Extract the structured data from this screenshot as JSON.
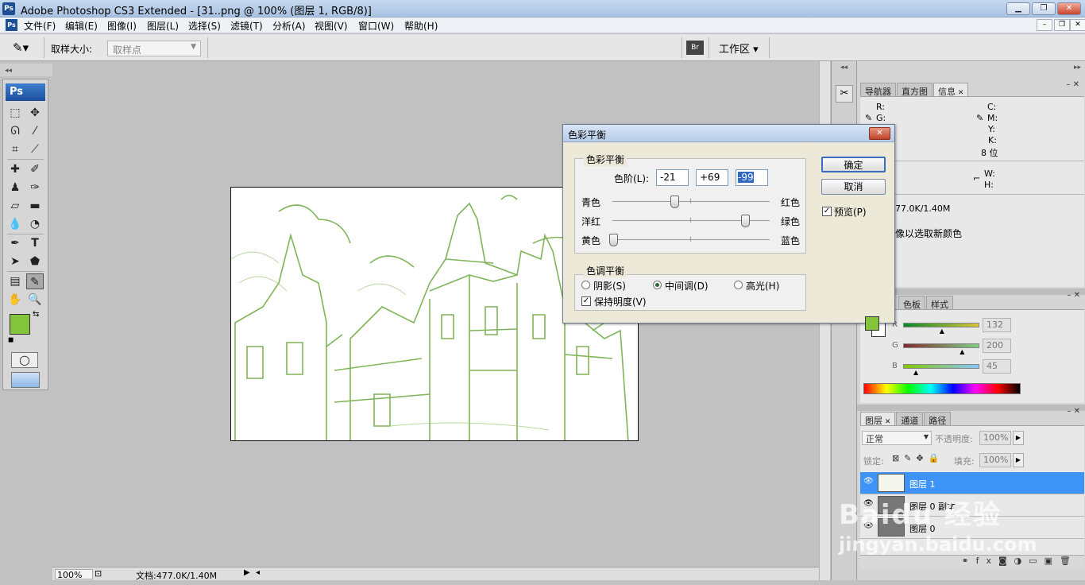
{
  "title_bar": {
    "app_badge": "Ps",
    "title": "Adobe Photoshop CS3 Extended - [31..png @ 100% (图层 1, RGB/8)]"
  },
  "menu": [
    "文件(F)",
    "编辑(E)",
    "图像(I)",
    "图层(L)",
    "选择(S)",
    "滤镜(T)",
    "分析(A)",
    "视图(V)",
    "窗口(W)",
    "帮助(H)"
  ],
  "options_bar": {
    "sample_size_label": "取样大小:",
    "sample_size_value": "取样点",
    "workspace_label": "工作区"
  },
  "toolbox": {
    "badge": "Ps",
    "foreground_color": "#84c43c",
    "background_color": "#ffffff"
  },
  "status_bar": {
    "zoom": "100%",
    "doc_size": "文档:477.0K/1.40M"
  },
  "dialog": {
    "title": "色彩平衡",
    "group_balance": "色彩平衡",
    "levels_label": "色阶(L):",
    "levels": [
      "-21",
      "+69",
      "-99"
    ],
    "sliders": [
      {
        "left": "青色",
        "right": "红色",
        "value": -21
      },
      {
        "left": "洋红",
        "right": "绿色",
        "value": 69
      },
      {
        "left": "黄色",
        "right": "蓝色",
        "value": -99
      }
    ],
    "group_tone": "色调平衡",
    "tone_options": [
      "阴影(S)",
      "中间调(D)",
      "高光(H)"
    ],
    "tone_selected": 1,
    "preserve_label": "保持明度(V)",
    "ok_label": "确定",
    "cancel_label": "取消",
    "preview_label": "预览(P)"
  },
  "info_panel": {
    "tabs": [
      "导航器",
      "直方图",
      "信息"
    ],
    "rgb_labels": [
      "R:",
      "G:"
    ],
    "cmyk_labels": [
      "C:",
      "M:",
      "Y:",
      "K:"
    ],
    "bit_depth": "8 位",
    "wh_labels": [
      "W:",
      "H:"
    ],
    "doc_size": "77.0K/1.40M",
    "hint": "像以选取新颜色"
  },
  "color_panel": {
    "tabs": [
      "色板",
      "样式"
    ],
    "channels": [
      {
        "label": "R",
        "value": "132"
      },
      {
        "label": "G",
        "value": "200"
      },
      {
        "label": "B",
        "value": "45"
      }
    ]
  },
  "layers_panel": {
    "tabs": [
      "图层",
      "通道",
      "路径"
    ],
    "blend_mode": "正常",
    "opacity_label": "不透明度:",
    "opacity_value": "100%",
    "lock_label": "锁定:",
    "fill_label": "填充:",
    "fill_value": "100%",
    "layers": [
      "图层 1",
      "图层 0 副本",
      "图层 0"
    ]
  },
  "watermark": {
    "brand": "Baidu 经验",
    "url": "jingyan.baidu.com"
  }
}
